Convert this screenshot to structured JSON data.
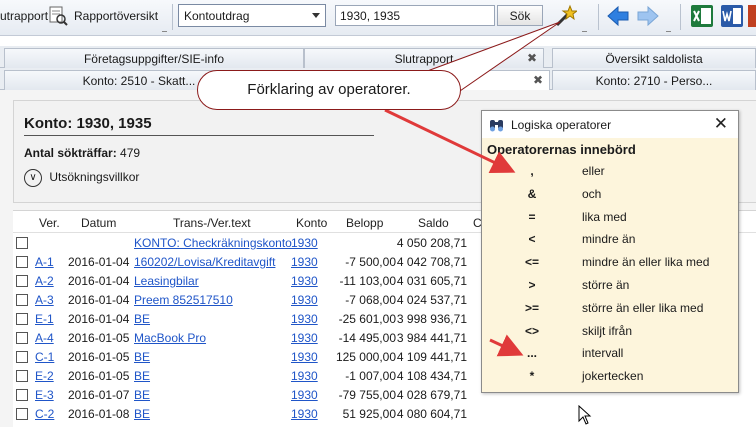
{
  "toolbar": {
    "report_label": "utrapport",
    "overview_label": "Rapportöversikt",
    "dropdown_value": "Kontoutdrag",
    "search_value": "1930, 1935",
    "search_button": "Sök"
  },
  "tabs_row1": [
    {
      "label": "Företagsuppgifter/SIE-info",
      "close": ""
    },
    {
      "label": "Slutrapport",
      "close": "✖"
    },
    {
      "label": "Översikt saldolista",
      "close": ""
    }
  ],
  "tabs_row2": [
    {
      "label": "Konto: 2510 - Skatt...",
      "close": ""
    },
    {
      "label": "",
      "close": "✖"
    },
    {
      "label": "Konto: 2710 - Perso...",
      "close": ""
    }
  ],
  "callout": "Förklaring av operatorer.",
  "header": {
    "title": "Konto: 1930, 1935",
    "hits_label": "Antal sökträffar:",
    "hits_value": "479",
    "criteria_label": "Utsökningsvillkor",
    "criteria_icon": "chevron-down-circle-icon"
  },
  "table": {
    "columns": [
      "Ver.",
      "Datum",
      "Trans-/Ver.text",
      "Konto",
      "Belopp",
      "Saldo",
      "C"
    ],
    "rows": [
      {
        "ver": "",
        "datum": "",
        "text": "KONTO: Checkräkningskonto",
        "konto": "1930",
        "belopp": "",
        "saldo": "4 050 208,71"
      },
      {
        "ver": "A-1",
        "datum": "2016-01-04",
        "text": "160202/Lovisa/Kreditavgift",
        "konto": "1930",
        "belopp": "-7 500,00",
        "saldo": "4 042 708,71"
      },
      {
        "ver": "A-2",
        "datum": "2016-01-04",
        "text": "Leasingbilar",
        "konto": "1930",
        "belopp": "-11 103,00",
        "saldo": "4 031 605,71"
      },
      {
        "ver": "A-3",
        "datum": "2016-01-04",
        "text": "Preem 852517510",
        "konto": "1930",
        "belopp": "-7 068,00",
        "saldo": "4 024 537,71"
      },
      {
        "ver": "E-1",
        "datum": "2016-01-04",
        "text": "BE",
        "konto": "1930",
        "belopp": "-25 601,00",
        "saldo": "3 998 936,71"
      },
      {
        "ver": "A-4",
        "datum": "2016-01-05",
        "text": "MacBook Pro",
        "konto": "1930",
        "belopp": "-14 495,00",
        "saldo": "3 984 441,71"
      },
      {
        "ver": "C-1",
        "datum": "2016-01-05",
        "text": "BE",
        "konto": "1930",
        "belopp": "125 000,00",
        "saldo": "4 109 441,71"
      },
      {
        "ver": "E-2",
        "datum": "2016-01-05",
        "text": "BE",
        "konto": "1930",
        "belopp": "-1 007,00",
        "saldo": "4 108 434,71"
      },
      {
        "ver": "E-3",
        "datum": "2016-01-07",
        "text": "BE",
        "konto": "1930",
        "belopp": "-79 755,00",
        "saldo": "4 028 679,71"
      },
      {
        "ver": "C-2",
        "datum": "2016-01-08",
        "text": "BE",
        "konto": "1930",
        "belopp": "51 925,00",
        "saldo": "4 080 604,71"
      }
    ]
  },
  "popup": {
    "title": "Logiska operatorer",
    "close": "✕",
    "heading": "Operatorernas innebörd",
    "operators": [
      {
        "symbol": ",",
        "meaning": "eller"
      },
      {
        "symbol": "&",
        "meaning": "och"
      },
      {
        "symbol": "=",
        "meaning": "lika med"
      },
      {
        "symbol": "<",
        "meaning": "mindre än"
      },
      {
        "symbol": "<=",
        "meaning": "mindre än eller lika med"
      },
      {
        "symbol": ">",
        "meaning": "större än"
      },
      {
        "symbol": ">=",
        "meaning": "större än eller lika med"
      },
      {
        "symbol": "<>",
        "meaning": "skiljt ifrån"
      },
      {
        "symbol": "...",
        "meaning": "intervall"
      },
      {
        "symbol": "*",
        "meaning": "jokertecken"
      }
    ]
  },
  "colors": {
    "link": "#1f55c8",
    "popup_bg": "#fdf5dc",
    "annotation_red": "#e03a3a"
  }
}
